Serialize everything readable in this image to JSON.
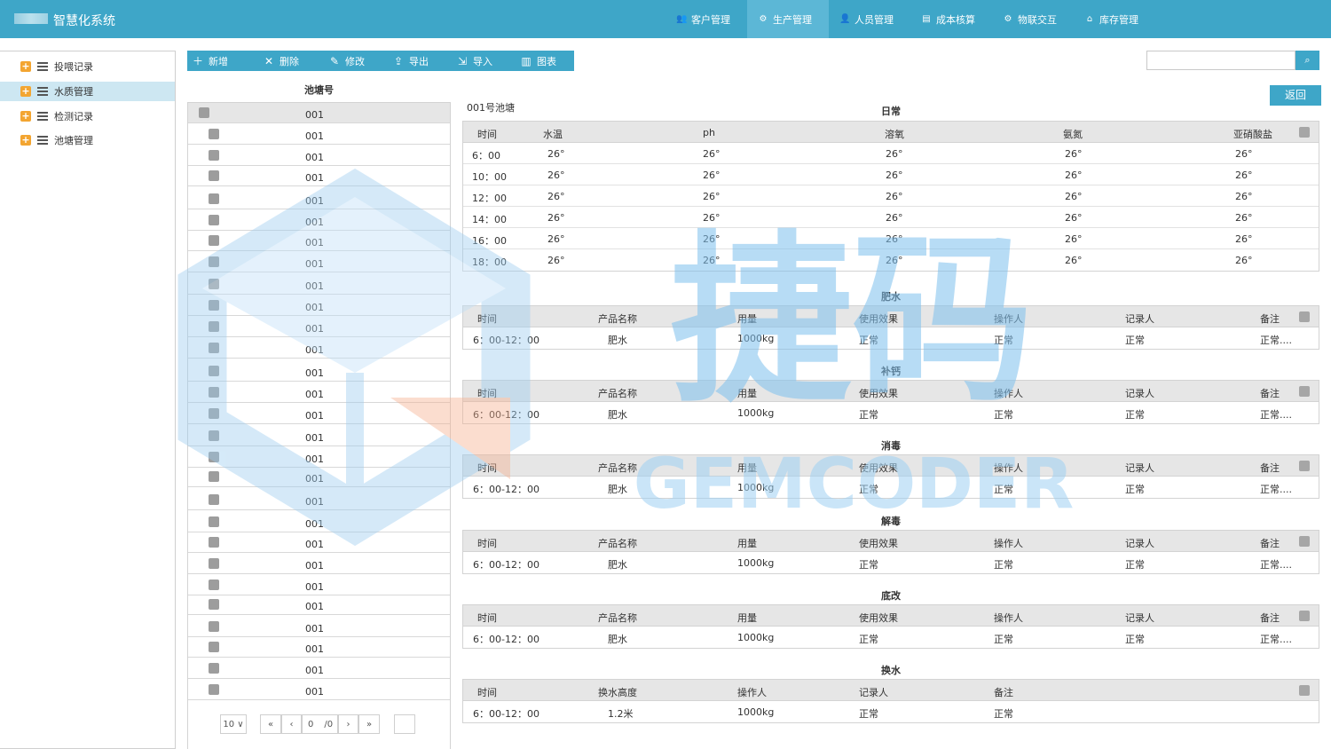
{
  "app": {
    "title": "智慧化系统"
  },
  "topnav": [
    {
      "label": "客户管理",
      "icon": "users-icon",
      "active": false
    },
    {
      "label": "生产管理",
      "icon": "production-icon",
      "active": true
    },
    {
      "label": "人员管理",
      "icon": "person-icon",
      "active": false
    },
    {
      "label": "成本核算",
      "icon": "ledger-icon",
      "active": false
    },
    {
      "label": "物联交互",
      "icon": "iot-icon",
      "active": false
    },
    {
      "label": "库存管理",
      "icon": "home-icon",
      "active": false
    }
  ],
  "sidebar": {
    "items": [
      {
        "label": "投喂记录",
        "active": false
      },
      {
        "label": "水质管理",
        "active": true
      },
      {
        "label": "检测记录",
        "active": false
      },
      {
        "label": "池塘管理",
        "active": false
      }
    ]
  },
  "toolbar": [
    {
      "label": "新增",
      "icon": "plus-icon"
    },
    {
      "label": "删除",
      "icon": "close-icon"
    },
    {
      "label": "修改",
      "icon": "edit-icon"
    },
    {
      "label": "导出",
      "icon": "export-icon"
    },
    {
      "label": "导入",
      "icon": "import-icon"
    },
    {
      "label": "图表",
      "icon": "chart-icon"
    }
  ],
  "search": {
    "placeholder": ""
  },
  "back_label": "返回",
  "pond_list": {
    "header": "池塘号",
    "rows": [
      "001",
      "001",
      "001",
      "001",
      "001",
      "001",
      "001",
      "001",
      "001",
      "001",
      "001",
      "001",
      "001",
      "001",
      "001",
      "001",
      "001",
      "001",
      "001",
      "001",
      "001",
      "001",
      "001",
      "001",
      "001",
      "001",
      "001",
      "001"
    ]
  },
  "pager": {
    "page_size": "10",
    "current": "0",
    "total": "/0"
  },
  "detail": {
    "pond_name": "001号池塘",
    "daily": {
      "title": "日常",
      "headers": [
        "时间",
        "水温",
        "ph",
        "溶氧",
        "氨氮",
        "亚硝酸盐"
      ],
      "rows": [
        [
          "6：00",
          "26°",
          "26°",
          "26°",
          "26°",
          "26°"
        ],
        [
          "10：00",
          "26°",
          "26°",
          "26°",
          "26°",
          "26°"
        ],
        [
          "12：00",
          "26°",
          "26°",
          "26°",
          "26°",
          "26°"
        ],
        [
          "14：00",
          "26°",
          "26°",
          "26°",
          "26°",
          "26°"
        ],
        [
          "16：00",
          "26°",
          "26°",
          "26°",
          "26°",
          "26°"
        ],
        [
          "18：00",
          "26°",
          "26°",
          "26°",
          "26°",
          "26°"
        ]
      ]
    },
    "sections": [
      {
        "title": "肥水",
        "headers": [
          "时间",
          "产品名称",
          "用量",
          "使用效果",
          "操作人",
          "记录人",
          "备注"
        ],
        "row": [
          "6：00-12：00",
          "肥水",
          "1000kg",
          "正常",
          "正常",
          "正常",
          "正常...."
        ]
      },
      {
        "title": "补钙",
        "headers": [
          "时间",
          "产品名称",
          "用量",
          "使用效果",
          "操作人",
          "记录人",
          "备注"
        ],
        "row": [
          "6：00-12：00",
          "肥水",
          "1000kg",
          "正常",
          "正常",
          "正常",
          "正常...."
        ]
      },
      {
        "title": "消毒",
        "headers": [
          "时间",
          "产品名称",
          "用量",
          "使用效果",
          "操作人",
          "记录人",
          "备注"
        ],
        "row": [
          "6：00-12：00",
          "肥水",
          "1000kg",
          "正常",
          "正常",
          "正常",
          "正常...."
        ]
      },
      {
        "title": "解毒",
        "headers": [
          "时间",
          "产品名称",
          "用量",
          "使用效果",
          "操作人",
          "记录人",
          "备注"
        ],
        "row": [
          "6：00-12：00",
          "肥水",
          "1000kg",
          "正常",
          "正常",
          "正常",
          "正常...."
        ]
      },
      {
        "title": "底改",
        "headers": [
          "时间",
          "产品名称",
          "用量",
          "使用效果",
          "操作人",
          "记录人",
          "备注"
        ],
        "row": [
          "6：00-12：00",
          "肥水",
          "1000kg",
          "正常",
          "正常",
          "正常",
          "正常...."
        ]
      }
    ],
    "exchange": {
      "title": "换水",
      "headers": [
        "时间",
        "换水高度",
        "操作人",
        "记录人",
        "备注"
      ],
      "row": [
        "6：00-12：00",
        "1.2米",
        "1000kg",
        "正常",
        "正常"
      ]
    }
  },
  "watermark": {
    "cn": "捷码",
    "en": "GEMCODER"
  }
}
